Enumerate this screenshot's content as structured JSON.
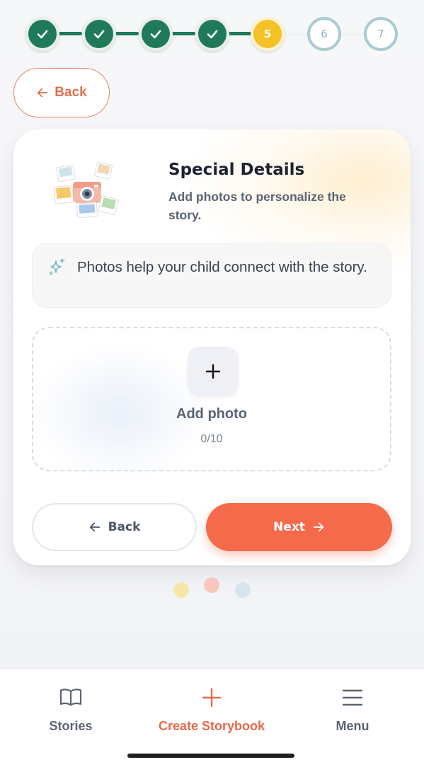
{
  "stepper": {
    "steps": [
      {
        "label": "",
        "state": "done"
      },
      {
        "label": "",
        "state": "done"
      },
      {
        "label": "",
        "state": "done"
      },
      {
        "label": "",
        "state": "done"
      },
      {
        "label": "5",
        "state": "current"
      },
      {
        "label": "6",
        "state": "todo"
      },
      {
        "label": "7",
        "state": "todo"
      }
    ],
    "current_step": 5,
    "total_steps": 7
  },
  "top_back": {
    "label": "Back",
    "icon": "arrow-left-icon"
  },
  "card": {
    "title": "Special Details",
    "subtitle": "Add photos to personalize the story.",
    "tip": {
      "icon": "sparkles-icon",
      "text": "Photos help your child connect with the story."
    },
    "upload": {
      "button_icon": "plus-icon",
      "label": "Add photo",
      "count": "0/10"
    },
    "footer": {
      "back_label": "Back",
      "next_label": "Next"
    }
  },
  "colors": {
    "accent": "#f46a4a",
    "done": "#1f7a5a",
    "current": "#f4c227",
    "todo_border": "#a9cbd2"
  },
  "bottom_nav": {
    "items": [
      {
        "label": "Stories",
        "icon": "book-icon",
        "active": false
      },
      {
        "label": "Create Storybook",
        "icon": "plus-icon",
        "active": true
      },
      {
        "label": "Menu",
        "icon": "menu-icon",
        "active": false
      }
    ]
  }
}
